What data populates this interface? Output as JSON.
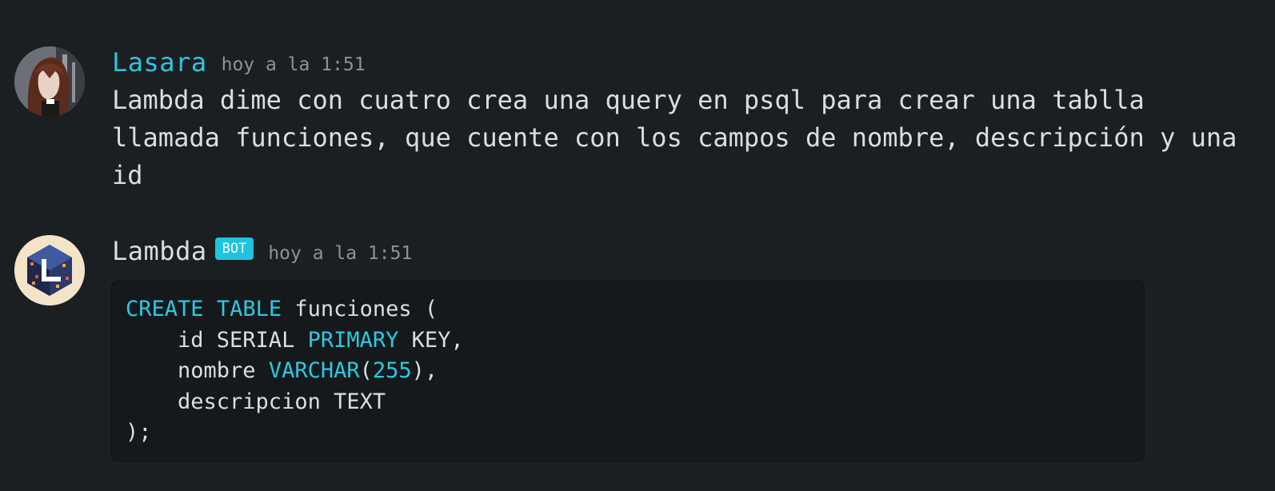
{
  "messages": [
    {
      "author": "Lasara",
      "timestamp": "hoy a la 1:51",
      "text": "Lambda dime con cuatro crea una query en psql para crear una tablla llamada funciones, que cuente con los campos de nombre, descripción y una id"
    },
    {
      "author": "Lambda",
      "badge": "BOT",
      "timestamp": "hoy a la 1:51",
      "code": {
        "line1": {
          "kw1": "CREATE",
          "kw2": "TABLE",
          "rest": " funciones ("
        },
        "line2": {
          "pre": "    id SERIAL ",
          "kw": "PRIMARY",
          "post": " KEY,"
        },
        "line3": {
          "pre": "    nombre ",
          "kw": "VARCHAR",
          "mid": "(",
          "num": "255",
          "post": "),"
        },
        "line4": "    descripcion TEXT",
        "line5": ");"
      }
    }
  ],
  "icons": {
    "lasara_avatar": "user-avatar-icon",
    "lambda_avatar": "bot-cube-logo-icon"
  },
  "colors": {
    "background": "#1c1f21",
    "accent_username": "#2dc6dc",
    "bot_badge": "#20c4de",
    "code_keyword": "#2cc9e0",
    "code_background": "#16191b"
  }
}
